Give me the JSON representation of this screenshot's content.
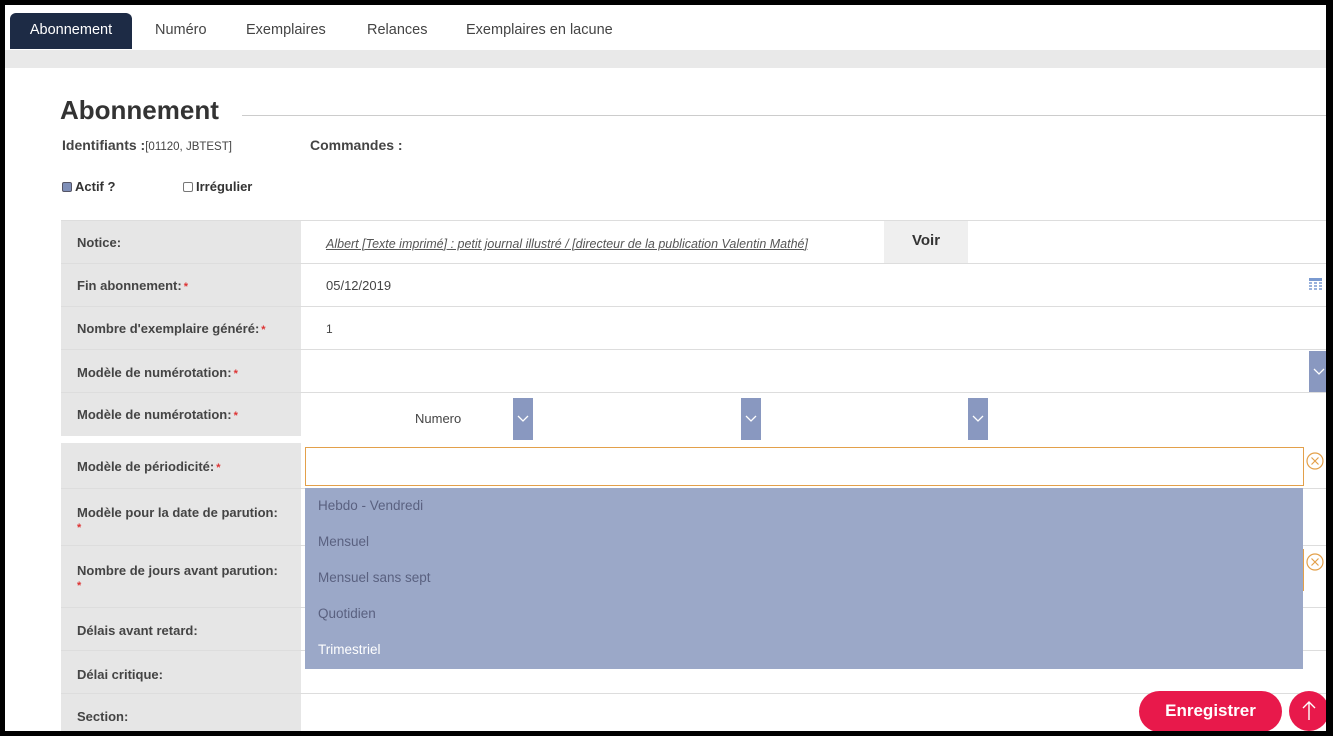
{
  "tabs": [
    {
      "label": "Abonnement",
      "active": true
    },
    {
      "label": "Numéro"
    },
    {
      "label": "Exemplaires"
    },
    {
      "label": "Relances"
    },
    {
      "label": "Exemplaires en lacune"
    }
  ],
  "header": {
    "title": "Abonnement",
    "identifiants_label": "Identifiants :",
    "identifiants_value": "[01120, JBTEST]",
    "commandes_label": "Commandes :",
    "actif_label": "Actif ?",
    "actif_checked": true,
    "irregulier_label": "Irrégulier",
    "irregulier_checked": false
  },
  "form": {
    "notice": {
      "label": "Notice:",
      "value": "Albert [Texte imprimé] : petit journal illustré / [directeur de la publication Valentin Mathé]",
      "button": "Voir"
    },
    "fin_abonnement": {
      "label": "Fin abonnement:",
      "required": "*",
      "value": "05/12/2019"
    },
    "nb_exemplaire": {
      "label": "Nombre d'exemplaire généré:",
      "required": "*",
      "value": "1"
    },
    "modele_numerotation_1": {
      "label": "Modèle de numérotation:",
      "required": "*",
      "value": ""
    },
    "modele_numerotation_2": {
      "label": "Modèle de numérotation:",
      "required": "*",
      "value": "Numero"
    },
    "modele_periodicite": {
      "label": "Modèle de périodicité:",
      "required": "*",
      "value": ""
    },
    "modele_date_parution": {
      "label": "Modèle pour la date de parution:",
      "required": "*"
    },
    "nb_jours_avant": {
      "label": "Nombre de jours avant parution:",
      "required": "*"
    },
    "delais_retard": {
      "label": "Délais avant retard:"
    },
    "delai_critique": {
      "label": "Délai critique:"
    },
    "section": {
      "label": "Section:"
    }
  },
  "dropdown": {
    "options": [
      "Hebdo - Vendredi",
      "Mensuel",
      "Mensuel sans sept",
      "Quotidien",
      "Trimestriel"
    ],
    "highlighted": "Trimestriel"
  },
  "footer": {
    "save_label": "Enregistrer"
  },
  "colors": {
    "tab_active": "#1d2b45",
    "accent_red": "#e8194b",
    "dropdown_bg": "#9ba8c8",
    "caret_bg": "#8998c0",
    "input_focus_border": "#e3a04a"
  },
  "icons": {
    "calendar": "calendar-icon",
    "caret": "chevron-down-icon",
    "clear": "clear-icon",
    "scroll_top": "arrow-up-icon"
  }
}
